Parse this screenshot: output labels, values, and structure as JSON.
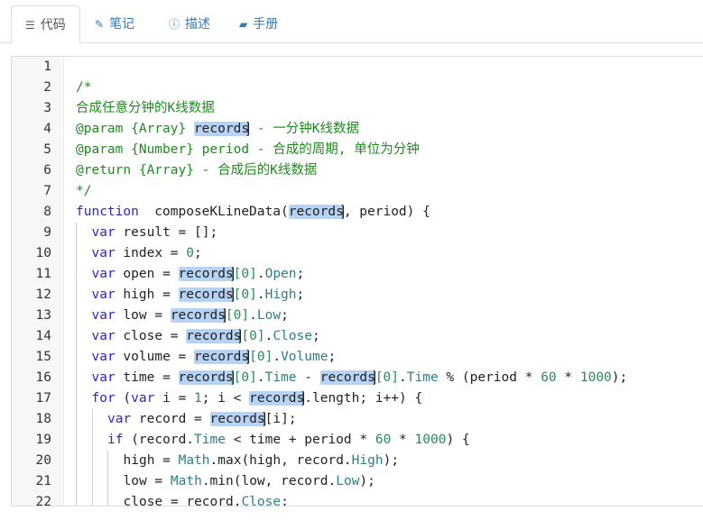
{
  "tabs": [
    {
      "label": "代码",
      "icon": "list-icon",
      "glyph": "☰",
      "active": true
    },
    {
      "label": "笔记",
      "icon": "edit-icon",
      "glyph": "✎",
      "active": false
    },
    {
      "label": "描述",
      "icon": "info-circle-icon",
      "glyph": "ⓘ",
      "active": false
    },
    {
      "label": "手册",
      "icon": "book-icon",
      "glyph": "▰",
      "active": false
    }
  ],
  "highlight_word": "records",
  "lines": [
    {
      "n": "1",
      "indent": 0,
      "t": []
    },
    {
      "n": "2",
      "indent": 0,
      "t": [
        [
          "c",
          "/*"
        ]
      ]
    },
    {
      "n": "3",
      "indent": 0,
      "t": [
        [
          "c",
          "合成任意分钟的K线数据"
        ]
      ]
    },
    {
      "n": "4",
      "indent": 0,
      "t": [
        [
          "c",
          "@param {Array} "
        ],
        [
          "hl",
          "records"
        ],
        [
          "c",
          " - 一分钟K线数据"
        ]
      ]
    },
    {
      "n": "5",
      "indent": 0,
      "t": [
        [
          "c",
          "@param {Number} period - 合成的周期, 单位为分钟"
        ]
      ]
    },
    {
      "n": "6",
      "indent": 0,
      "t": [
        [
          "c",
          "@return {Array} - 合成后的K线数据"
        ]
      ]
    },
    {
      "n": "7",
      "indent": 0,
      "t": [
        [
          "c",
          "*/"
        ]
      ]
    },
    {
      "n": "8",
      "indent": 0,
      "t": [
        [
          "k",
          "function"
        ],
        [
          "",
          "  composeKLineData("
        ],
        [
          "hl",
          "records"
        ],
        [
          "",
          ", period) {"
        ]
      ]
    },
    {
      "n": "9",
      "indent": 1,
      "t": [
        [
          "k",
          "var"
        ],
        [
          "",
          " result = [];"
        ]
      ]
    },
    {
      "n": "10",
      "indent": 1,
      "t": [
        [
          "k",
          "var"
        ],
        [
          "",
          " index = "
        ],
        [
          "n",
          "0"
        ],
        [
          "",
          ";"
        ]
      ]
    },
    {
      "n": "11",
      "indent": 1,
      "t": [
        [
          "k",
          "var"
        ],
        [
          "",
          " open = "
        ],
        [
          "hl",
          "records"
        ],
        [
          "n",
          "[0]"
        ],
        [
          "",
          "."
        ],
        [
          "p",
          "Open"
        ],
        [
          "",
          ";"
        ]
      ]
    },
    {
      "n": "12",
      "indent": 1,
      "t": [
        [
          "k",
          "var"
        ],
        [
          "",
          " high = "
        ],
        [
          "hl",
          "records"
        ],
        [
          "n",
          "[0]"
        ],
        [
          "",
          "."
        ],
        [
          "p",
          "High"
        ],
        [
          "",
          ";"
        ]
      ]
    },
    {
      "n": "13",
      "indent": 1,
      "t": [
        [
          "k",
          "var"
        ],
        [
          "",
          " low = "
        ],
        [
          "hl",
          "records"
        ],
        [
          "n",
          "[0]"
        ],
        [
          "",
          "."
        ],
        [
          "p",
          "Low"
        ],
        [
          "",
          ";"
        ]
      ]
    },
    {
      "n": "14",
      "indent": 1,
      "t": [
        [
          "k",
          "var"
        ],
        [
          "",
          " close = "
        ],
        [
          "hl",
          "records"
        ],
        [
          "n",
          "[0]"
        ],
        [
          "",
          "."
        ],
        [
          "p",
          "Close"
        ],
        [
          "",
          ";"
        ]
      ]
    },
    {
      "n": "15",
      "indent": 1,
      "t": [
        [
          "k",
          "var"
        ],
        [
          "",
          " volume = "
        ],
        [
          "hl",
          "records"
        ],
        [
          "n",
          "[0]"
        ],
        [
          "",
          "."
        ],
        [
          "p",
          "Volume"
        ],
        [
          "",
          ";"
        ]
      ]
    },
    {
      "n": "16",
      "indent": 1,
      "t": [
        [
          "k",
          "var"
        ],
        [
          "",
          " time = "
        ],
        [
          "hl",
          "records"
        ],
        [
          "n",
          "[0]"
        ],
        [
          "",
          "."
        ],
        [
          "p",
          "Time"
        ],
        [
          "",
          " - "
        ],
        [
          "hl",
          "records"
        ],
        [
          "n",
          "[0]"
        ],
        [
          "",
          "."
        ],
        [
          "p",
          "Time"
        ],
        [
          "",
          " % (period * "
        ],
        [
          "n",
          "60"
        ],
        [
          "",
          " * "
        ],
        [
          "n",
          "1000"
        ],
        [
          "",
          ");"
        ]
      ]
    },
    {
      "n": "17",
      "indent": 1,
      "t": [
        [
          "k",
          "for"
        ],
        [
          "",
          " ("
        ],
        [
          "k",
          "var"
        ],
        [
          "",
          " i = "
        ],
        [
          "n",
          "1"
        ],
        [
          "",
          "; i < "
        ],
        [
          "hl",
          "records"
        ],
        [
          "",
          ".length; i++) {"
        ]
      ]
    },
    {
      "n": "18",
      "indent": 2,
      "t": [
        [
          "k",
          "var"
        ],
        [
          "",
          " record = "
        ],
        [
          "hl",
          "records"
        ],
        [
          "",
          "[i];"
        ]
      ]
    },
    {
      "n": "19",
      "indent": 2,
      "t": [
        [
          "k",
          "if"
        ],
        [
          "",
          " (record."
        ],
        [
          "p",
          "Time"
        ],
        [
          "",
          " < time + period * "
        ],
        [
          "n",
          "60"
        ],
        [
          "",
          " * "
        ],
        [
          "n",
          "1000"
        ],
        [
          "",
          ") {"
        ]
      ]
    },
    {
      "n": "20",
      "indent": 3,
      "t": [
        [
          "",
          "high = "
        ],
        [
          "p",
          "Math"
        ],
        [
          "",
          ".max(high, record."
        ],
        [
          "p",
          "High"
        ],
        [
          "",
          ");"
        ]
      ]
    },
    {
      "n": "21",
      "indent": 3,
      "t": [
        [
          "",
          "low = "
        ],
        [
          "p",
          "Math"
        ],
        [
          "",
          ".min(low, record."
        ],
        [
          "p",
          "Low"
        ],
        [
          "",
          ");"
        ]
      ]
    },
    {
      "n": "22",
      "indent": 3,
      "t": [
        [
          "",
          "close = record."
        ],
        [
          "p",
          "Close"
        ],
        [
          "",
          ";"
        ]
      ]
    }
  ]
}
